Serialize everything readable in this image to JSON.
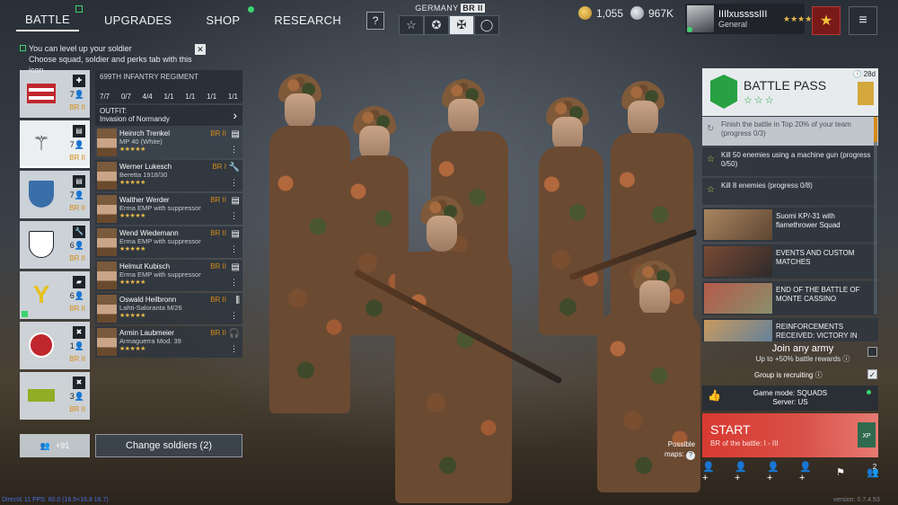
{
  "nav": {
    "items": [
      {
        "label": "BATTLE",
        "active": true,
        "marker": "square"
      },
      {
        "label": "UPGRADES",
        "active": false,
        "marker": ""
      },
      {
        "label": "SHOP",
        "active": false,
        "marker": "dot"
      },
      {
        "label": "RESEARCH",
        "active": false,
        "marker": ""
      }
    ],
    "help": "?"
  },
  "nation": {
    "title": "GERMANY",
    "br": "BR II",
    "tabs": [
      "☆",
      "✪",
      "✠",
      "◯"
    ],
    "selected_index": 2
  },
  "currency": {
    "gold": "1,055",
    "silver": "967K"
  },
  "profile": {
    "name": "IIIlxussssIII",
    "rank": "General",
    "stars": "★★★★"
  },
  "notice": {
    "line1": "You can level up your soldier",
    "line2": "Choose squad, soldier and perks tab with this icon",
    "close": "✕"
  },
  "squads": [
    {
      "count": "7",
      "br": "BR II",
      "color": "#1d2329",
      "selected": false,
      "level_up": false
    },
    {
      "count": "7",
      "br": "BR II",
      "color": "#1d2329",
      "selected": true,
      "level_up": false
    },
    {
      "count": "7",
      "br": "BR II",
      "color": "#3a6ea8",
      "selected": false,
      "level_up": false
    },
    {
      "count": "6",
      "br": "BR II",
      "color": "#1d2329",
      "selected": false,
      "level_up": false
    },
    {
      "count": "6",
      "br": "BR II",
      "color": "#e6c21e",
      "selected": false,
      "level_up": true
    },
    {
      "count": "1",
      "br": "BR II",
      "color": "#c0262d",
      "selected": false,
      "level_up": false
    },
    {
      "count": "3",
      "br": "BR II",
      "color": "#8fae25",
      "selected": false,
      "level_up": false
    }
  ],
  "regiment": {
    "name": "699TH INFANTRY REGIMENT",
    "stats": [
      "7/7",
      "0/7",
      "4/4",
      "1/1",
      "1/1",
      "1/1",
      "1/1"
    ]
  },
  "outfit": {
    "label": "OUTFIT:",
    "value": "Invasion of Normandy"
  },
  "soldiers": [
    {
      "name": "Heinrch Trenkel",
      "weapon": "MP 40 (White)",
      "br": "BR II",
      "stars": "★★★★★"
    },
    {
      "name": "Werner Lukesch",
      "weapon": "Beretta 1918/30",
      "br": "BR I",
      "stars": "★★★★★"
    },
    {
      "name": "Walther Werder",
      "weapon": "Erma EMP with suppressor",
      "br": "BR II",
      "stars": "★★★★★"
    },
    {
      "name": "Wend Wiedemann",
      "weapon": "Erma EMP with suppressor",
      "br": "BR II",
      "stars": "★★★★★"
    },
    {
      "name": "Helmut Kubisch",
      "weapon": "Erma EMP with suppressor",
      "br": "BR II",
      "stars": "★★★★★"
    },
    {
      "name": "Oswald Heilbronn",
      "weapon": "Lahti-Saloranta M/26",
      "br": "BR II",
      "stars": "★★★★★"
    },
    {
      "name": "Armin Laubmeier",
      "weapon": "Armaguerra Mod. 39",
      "br": "BR II",
      "stars": "★★★★★"
    }
  ],
  "bottom_left": {
    "friends": "+91",
    "change_button": "Change soldiers (2)"
  },
  "battle_pass": {
    "title": "BATTLE PASS",
    "stars": "☆☆☆",
    "days": "28d"
  },
  "tasks": [
    {
      "text": "Finish the battle in Top 20% of your team (progress 0/3)"
    },
    {
      "text": "Kill 50 enemies using a machine gun (progress 0/50)"
    },
    {
      "text": "Kill 8 enemies (progress 0/8)"
    }
  ],
  "news": [
    {
      "title": "Suomi KP/-31 with flamethrower Squad",
      "color": "#8a6a45"
    },
    {
      "title": "EVENTS AND CUSTOM MATCHES",
      "color": "#6a3d2c"
    },
    {
      "title": "END OF THE BATTLE OF MONTE CASSINO",
      "color": "#8f4a3a"
    },
    {
      "title": "REINFORCEMENTS RECEIVED: VICTORY IN EUROPE DAY",
      "color": "#b98550"
    }
  ],
  "join_army": {
    "title": "Join any army",
    "sub": "Up to +50% battle rewards"
  },
  "group_recruiting": "Group is recruiting",
  "game_mode": {
    "line1": "Game mode: SQUADS",
    "line2": "Server: US"
  },
  "start": {
    "label": "START",
    "sub": "BR of the battle: I - III",
    "xp": "XP"
  },
  "maps": {
    "line1": "Possible",
    "line2": "maps:"
  },
  "party": {
    "count": "2"
  },
  "footer": {
    "fps": "DirectX 11 FPS: 60.0 (16.5<16.8 16.7)",
    "version": "version: 0.7.4.53"
  }
}
